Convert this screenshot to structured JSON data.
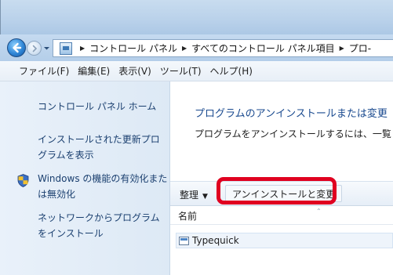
{
  "address": {
    "crumbs": [
      "コントロール パネル",
      "すべてのコントロール パネル項目",
      "プロ-"
    ]
  },
  "menu": {
    "items": [
      "ファイル(F)",
      "編集(E)",
      "表示(V)",
      "ツール(T)",
      "ヘルプ(H)"
    ]
  },
  "sidebar": {
    "items": [
      {
        "line1": "コントロール パネル ホーム",
        "line2": ""
      },
      {
        "line1": "インストールされた更新プロ",
        "line2": "グラムを表示"
      },
      {
        "line1": "Windows の機能の有効化また",
        "line2": "は無効化"
      },
      {
        "line1": "ネットワークからプログラム",
        "line2": "をインストール"
      }
    ]
  },
  "main": {
    "title": "プログラムのアンインストールまたは変更",
    "description": "プログラムをアンインストールするには、一覧"
  },
  "toolbar": {
    "organize_label": "整理",
    "organize_arrow": "▼",
    "uninstall_label": "アンインストールと変更"
  },
  "list": {
    "column_name": "名前",
    "sort_indicator": "⌃",
    "rows": [
      {
        "name": "Typequick"
      }
    ]
  },
  "colors": {
    "highlight": "#e00020",
    "link": "#1a3f6f",
    "title": "#1a4a8f"
  },
  "icons": {
    "back": "back-arrow-icon",
    "forward": "forward-arrow-icon",
    "dropdown": "dropdown-icon",
    "control_panel": "control-panel-icon",
    "shield": "windows-shield-icon",
    "program": "program-icon"
  }
}
